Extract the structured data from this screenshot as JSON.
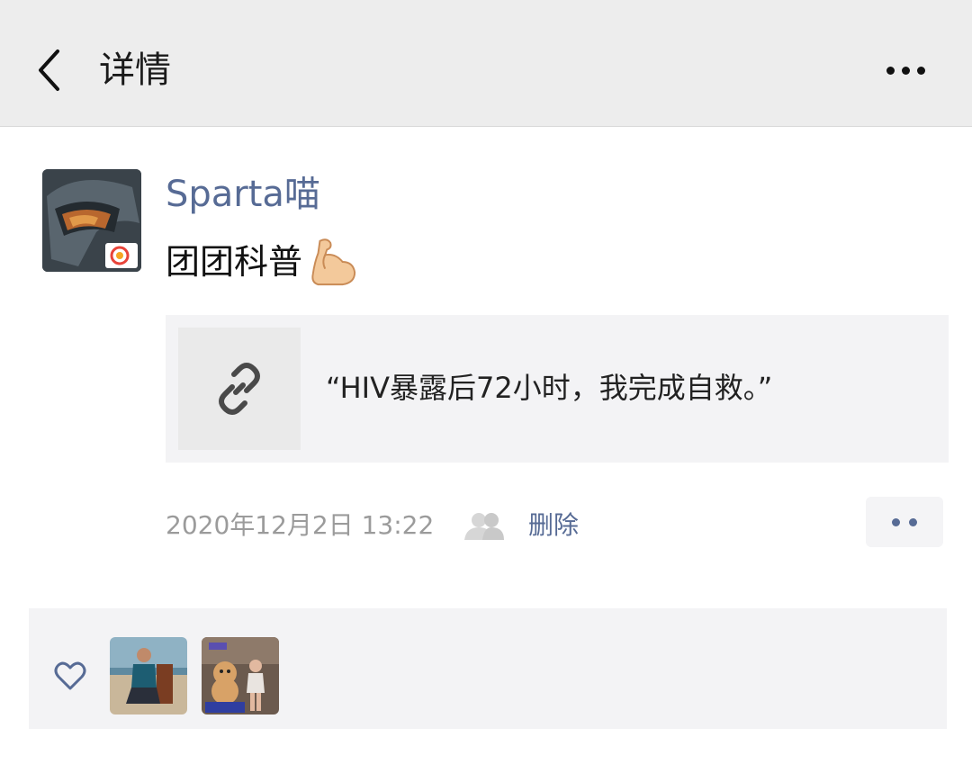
{
  "header": {
    "title": "详情",
    "back_icon": "chevron-left-icon",
    "more_icon": "more-dots-icon"
  },
  "post": {
    "username": "Sparta喵",
    "text": "团团科普",
    "emoji": "flexed-biceps-icon",
    "link": {
      "icon": "link-icon",
      "title": "“HIV暴露后72小时，我完成自救。”"
    },
    "time": "2020年12月2日 13:22",
    "visibility_icon": "people-icon",
    "delete_label": "删除",
    "action_icon": "comment-more-icon"
  },
  "likes": {
    "icon": "heart-icon",
    "likers": [
      {
        "name": "liker-1"
      },
      {
        "name": "liker-2"
      }
    ]
  },
  "colors": {
    "name_blue": "#576b95",
    "header_bg": "#ededed",
    "card_bg": "#f3f3f5",
    "meta_gray": "#9b9b9b"
  }
}
